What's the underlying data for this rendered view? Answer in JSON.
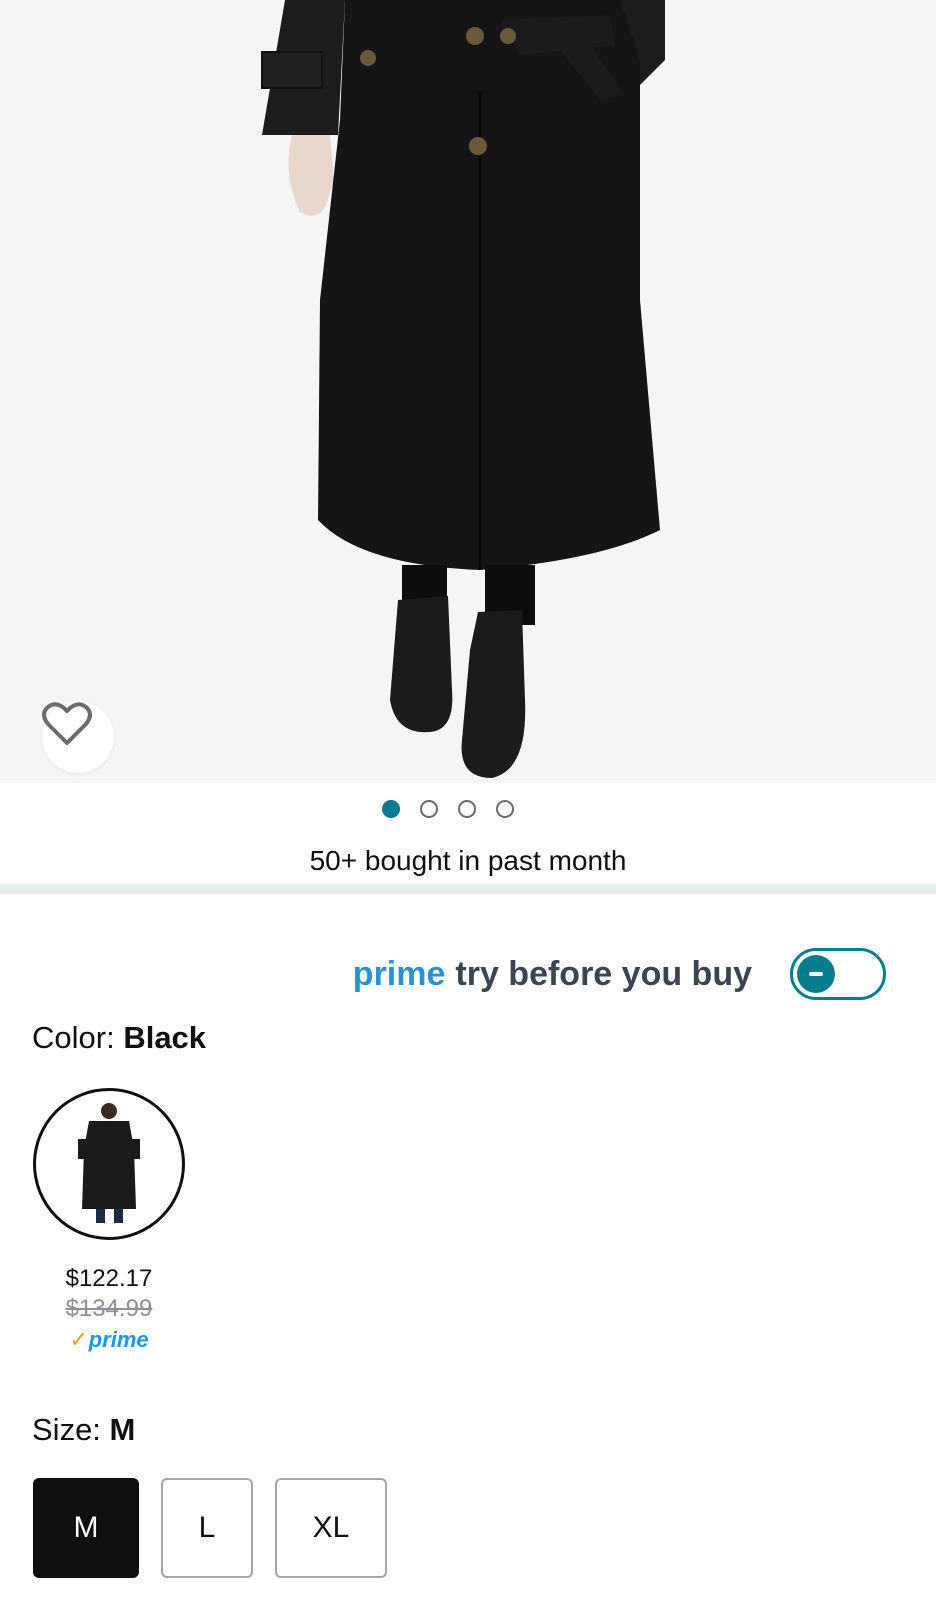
{
  "product_image": {
    "alt_icon": "trench-coat-photo"
  },
  "wishlist": {
    "icon": "heart-icon"
  },
  "carousel": {
    "count": 4,
    "active_index": 0
  },
  "social_proof": {
    "text": "50+ bought in past month"
  },
  "try_before_buy": {
    "prime": "prime",
    "text": "try before you buy",
    "toggle_on": false
  },
  "color": {
    "label": "Color: ",
    "value": "Black"
  },
  "swatch": {
    "price": "$122.17",
    "list_price": "$134.99",
    "badge_check": "✓",
    "badge_text": "prime"
  },
  "size": {
    "label": "Size: ",
    "value": "M",
    "options": [
      "M",
      "L",
      "XL"
    ],
    "selected": "M"
  },
  "colors": {
    "teal": "#067d8e",
    "prime_blue": "#2a93cf",
    "prime_check": "#f89e1a"
  }
}
